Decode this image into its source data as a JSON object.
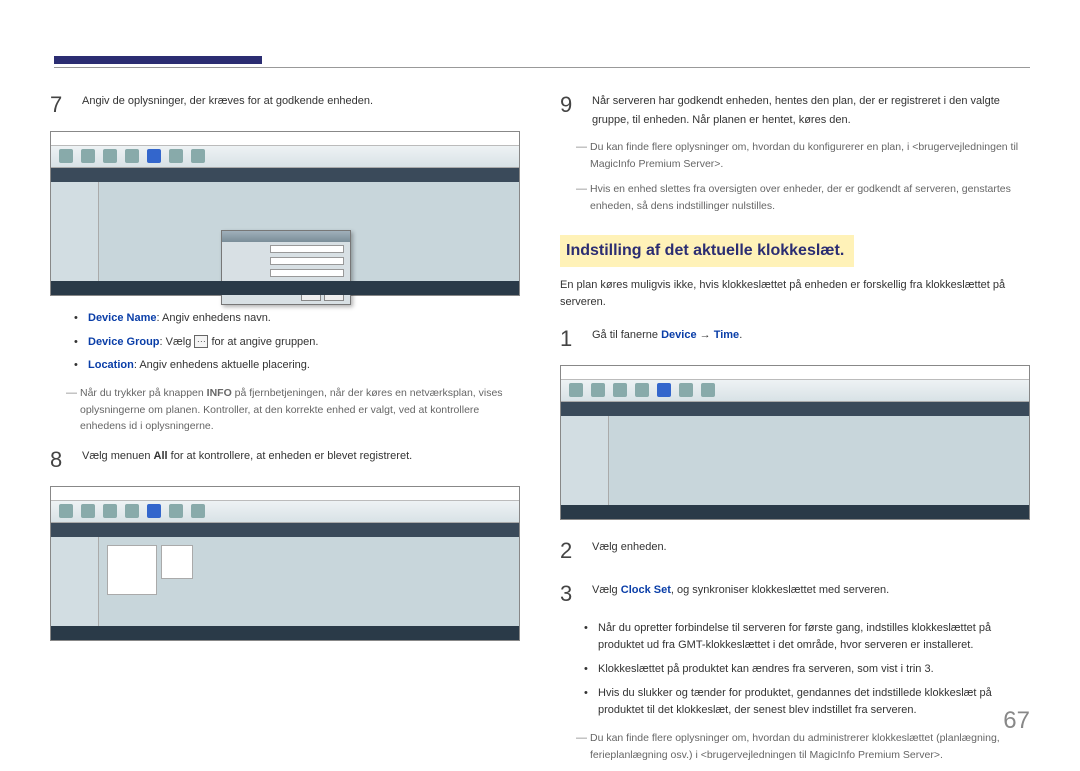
{
  "left": {
    "step7": {
      "num": "7",
      "text": "Angiv de oplysninger, der kræves for at godkende enheden.",
      "bullets": {
        "deviceName": {
          "term": "Device Name",
          "rest": ": Angiv enhedens navn."
        },
        "deviceGroup": {
          "term": "Device Group",
          "rest_a": ": Vælg ",
          "rest_b": " for at angive gruppen."
        },
        "location": {
          "term": "Location",
          "rest": ": Angiv enhedens aktuelle placering."
        }
      },
      "note_a": "Når du trykker på knappen ",
      "note_info": "INFO",
      "note_b": " på fjernbetjeningen, når der køres en netværksplan, vises oplysningerne om planen. Kontroller, at den korrekte enhed er valgt, ved at kontrollere enhedens id i oplysningerne."
    },
    "step8": {
      "num": "8",
      "text_a": "Vælg menuen ",
      "text_all": "All",
      "text_b": " for at kontrollere, at enheden er blevet registreret."
    }
  },
  "right": {
    "step9": {
      "num": "9",
      "text": "Når serveren har godkendt enheden, hentes den plan, der er registreret i den valgte gruppe, til enheden. Når planen er hentet, køres den.",
      "note1": "Du kan finde flere oplysninger om, hvordan du konfigurerer en plan, i <brugervejledningen til MagicInfo Premium Server>.",
      "note2": "Hvis en enhed slettes fra oversigten over enheder, der er godkendt af serveren, genstartes enheden, så dens indstillinger nulstilles."
    },
    "section_title": "Indstilling af det aktuelle klokkeslæt.",
    "intro": "En plan køres muligvis ikke, hvis klokkeslættet på enheden er forskellig fra klokkeslættet på serveren.",
    "step1": {
      "num": "1",
      "text_a": "Gå til fanerne ",
      "device": "Device",
      "arrow": " → ",
      "time": "Time",
      "period": "."
    },
    "step2": {
      "num": "2",
      "text": "Vælg enheden."
    },
    "step3": {
      "num": "3",
      "text_a": "Vælg ",
      "clockset": "Clock Set",
      "text_b": ", og synkroniser klokkeslættet med serveren."
    },
    "bullets": {
      "b1": "Når du opretter forbindelse til serveren for første gang, indstilles klokkeslættet på produktet ud fra GMT-klokkeslættet i det område, hvor serveren er installeret.",
      "b2": "Klokkeslættet på produktet kan ændres fra serveren, som vist i trin 3.",
      "b3": "Hvis du slukker og tænder for produktet, gendannes det indstillede klokkeslæt på produktet til det klokkeslæt, der senest blev indstillet fra serveren."
    },
    "note3": "Du kan finde flere oplysninger om, hvordan du administrerer klokkeslættet (planlægning, ferieplanlægning osv.) i <brugervejledningen til MagicInfo Premium Server>."
  },
  "page_number": "67"
}
